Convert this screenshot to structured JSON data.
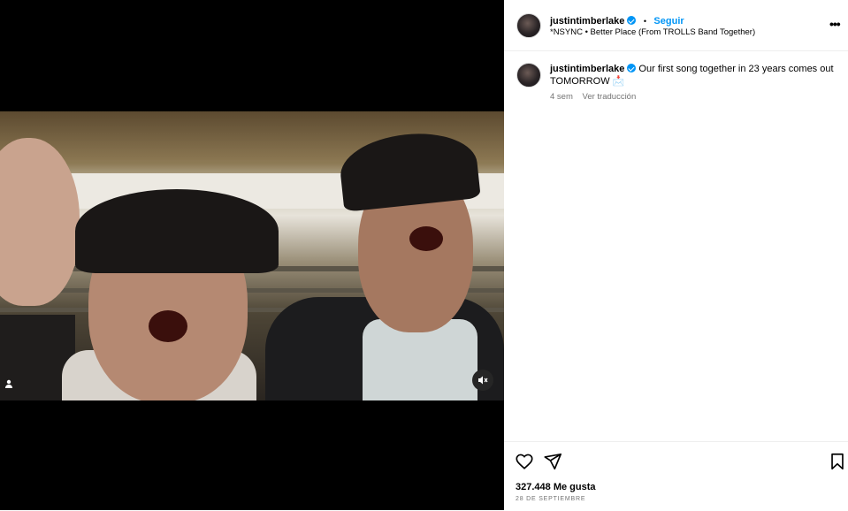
{
  "post": {
    "author": "justintimberlake",
    "follow_label": "Seguir",
    "separator": "•",
    "audio": "*NSYNC • Better Place (From TROLLS Band Together)",
    "more_label": "•••"
  },
  "caption": {
    "author": "justintimberlake",
    "text": "Our first song together in 23 years comes out TOMORROW 📩",
    "age": "4 sem",
    "translate_label": "Ver traducción"
  },
  "stats": {
    "likes": "327.448 Me gusta",
    "date": "28 DE SEPTIEMBRE"
  },
  "icons": {
    "like": "heart-icon",
    "share": "send-icon",
    "save": "bookmark-icon",
    "mute": "muted-speaker-icon",
    "tagged": "user-tag-icon",
    "more": "more-options-icon"
  },
  "colors": {
    "accent": "#0095f6",
    "secondary_text": "#737373",
    "divider": "#efefef",
    "media_bg": "#000000"
  }
}
